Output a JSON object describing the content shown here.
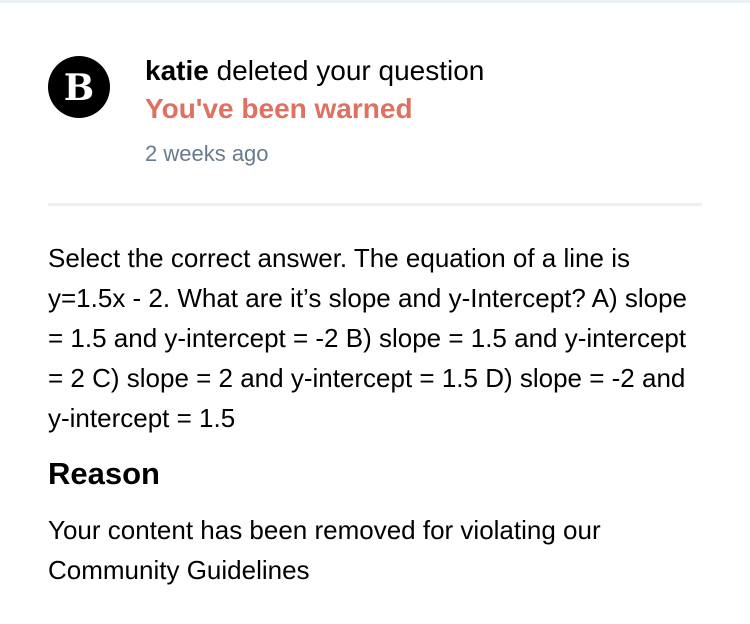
{
  "notification": {
    "avatar_letter": "B",
    "username": "katie",
    "action_text": " deleted your question",
    "warning": "You've been warned",
    "timestamp": "2 weeks ago"
  },
  "question": {
    "text": "Select the correct answer. The equation of a line is y=1.5x - 2. What are it’s slope and y-Intercept? A) slope = 1.5 and y-intercept = -2 B) slope = 1.5 and y-intercept = 2 C) slope = 2 and y-intercept = 1.5 D) slope = -2 and y-intercept = 1.5"
  },
  "reason": {
    "heading": "Reason",
    "text": "Your content has been removed for violating our Community Guidelines"
  },
  "colors": {
    "warning": "#e07060",
    "timestamp": "#687b8c",
    "divider": "#ebf0f3",
    "avatar_bg": "#000000"
  }
}
